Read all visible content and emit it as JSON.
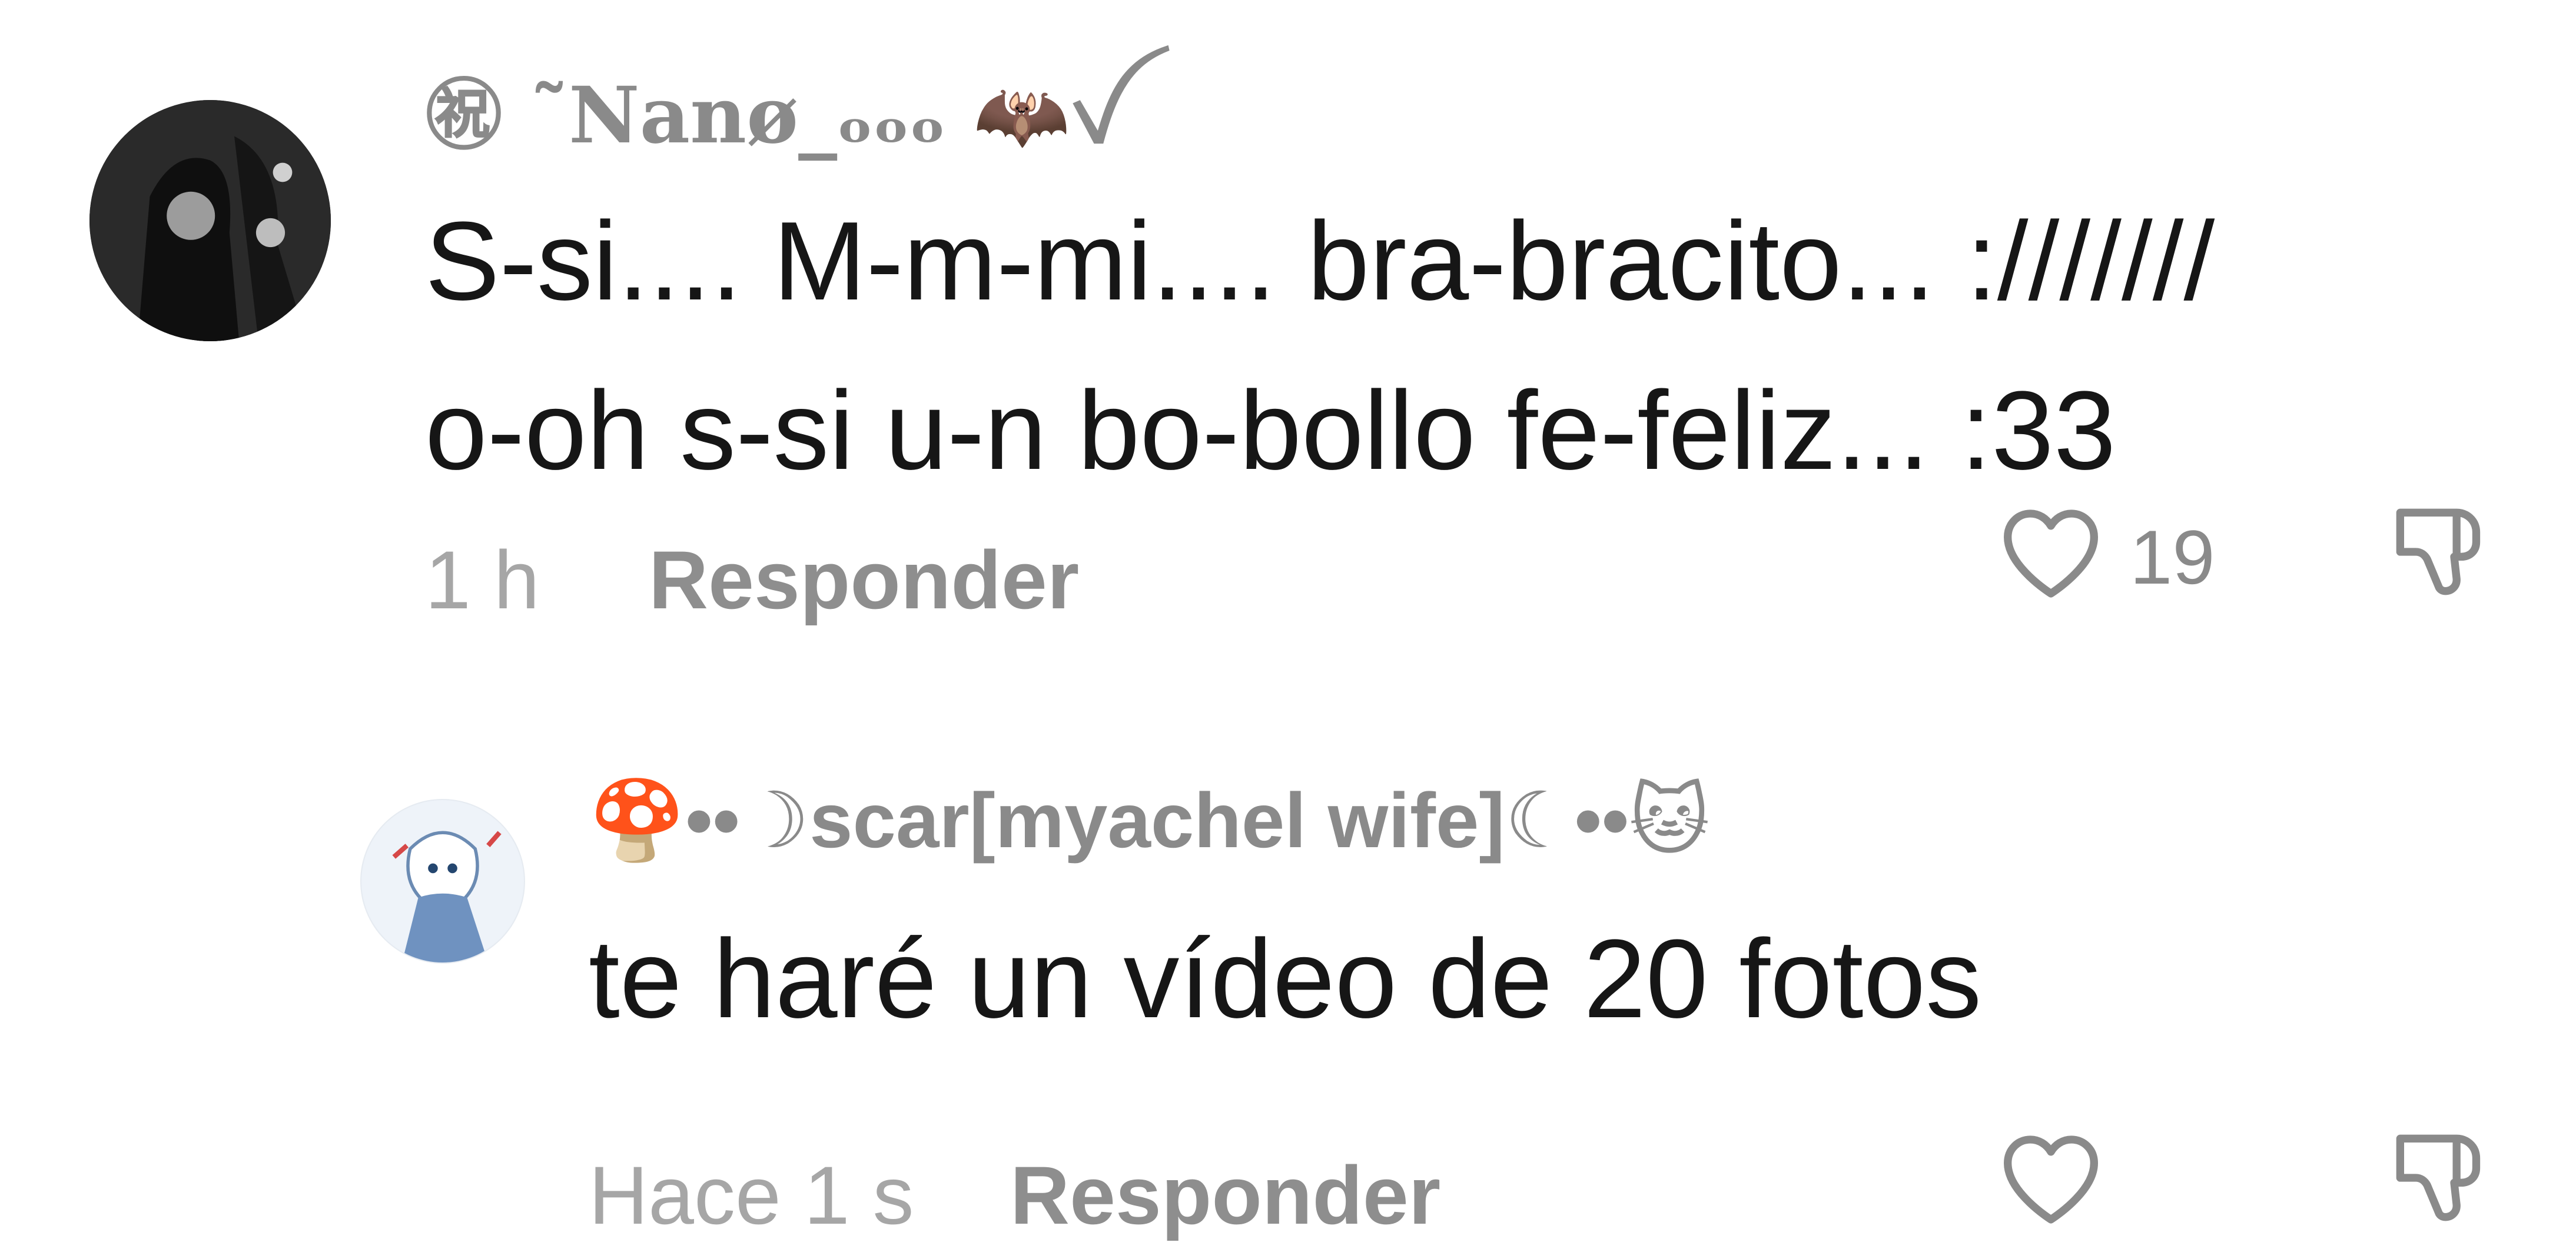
{
  "comments": [
    {
      "username": "㊗︎ ˜Nanø_ₒₒₒ 🦇ꪜ",
      "text": "S-si.... M-m-mi.... bra-bracito... :///////\no-oh s-si u-n bo-bollo fe-feliz... :33",
      "time": "1 h",
      "reply_label": "Responder",
      "like_count": "19"
    },
    {
      "username": "🍄••☽scar[myachel wife]☾••🐱",
      "text": "te haré un vídeo de 20 fotos",
      "time": "Hace 1 s",
      "reply_label": "Responder"
    }
  ]
}
